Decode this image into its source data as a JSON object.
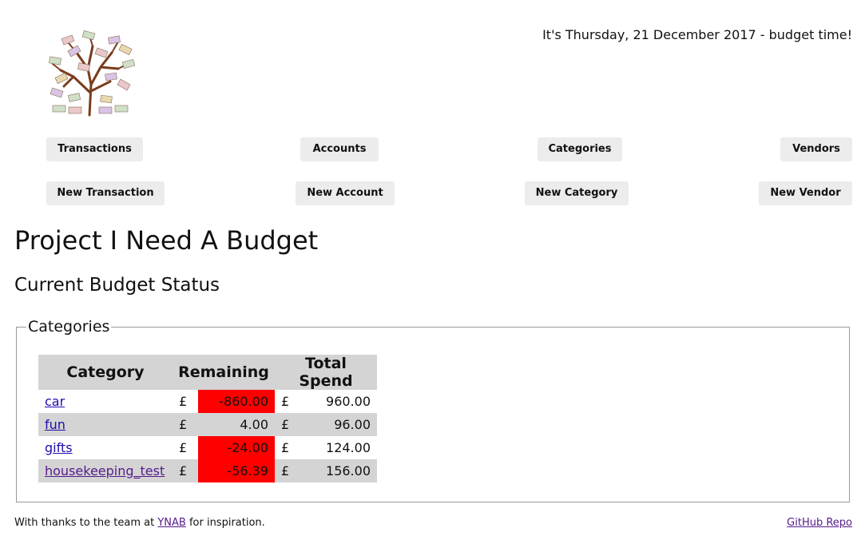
{
  "header": {
    "date_line": "It's Thursday, 21 December 2017 - budget time!"
  },
  "nav": {
    "row1": [
      "Transactions",
      "Accounts",
      "Categories",
      "Vendors"
    ],
    "row2": [
      "New Transaction",
      "New Account",
      "New Category",
      "New Vendor"
    ]
  },
  "page": {
    "title": "Project I Need A Budget",
    "subtitle": "Current Budget Status"
  },
  "categories": {
    "legend": "Categories",
    "headers": [
      "Category",
      "Remaining",
      "Total Spend"
    ],
    "currency": "£",
    "rows": [
      {
        "name": "car",
        "remaining": "-860.00",
        "spend": "960.00",
        "negative": true
      },
      {
        "name": "fun",
        "remaining": "4.00",
        "spend": "96.00",
        "negative": false
      },
      {
        "name": "gifts",
        "remaining": "-24.00",
        "spend": "124.00",
        "negative": true
      },
      {
        "name": "housekeeping_test",
        "remaining": "-56.39",
        "spend": "156.00",
        "negative": true
      }
    ],
    "negative_color": "#ff0000"
  },
  "footer": {
    "thanks_prefix": "With thanks to the team at ",
    "ynab_link": "YNAB",
    "thanks_suffix": " for inspiration.",
    "github_link": "GitHub Repo"
  }
}
